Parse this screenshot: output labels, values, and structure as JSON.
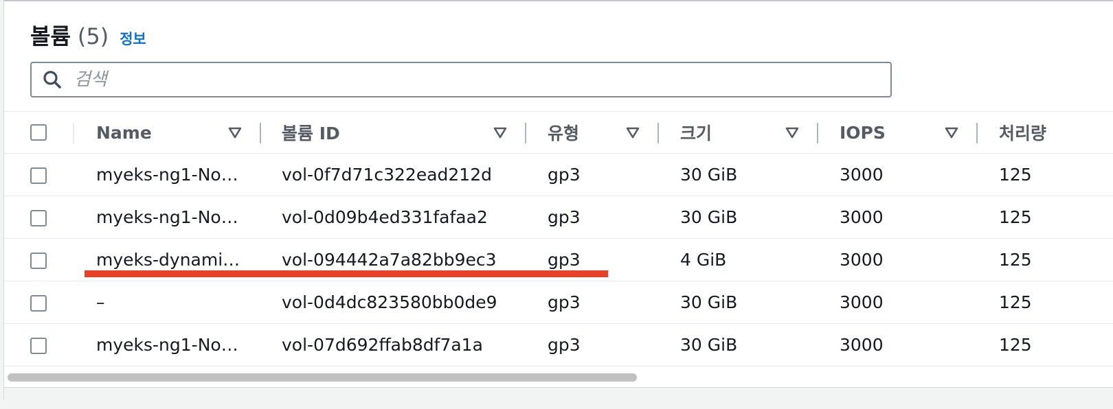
{
  "header": {
    "title": "볼륨",
    "count": "(5)",
    "info_link": "정보"
  },
  "search": {
    "placeholder": "검색",
    "value": ""
  },
  "columns": [
    {
      "label": "Name"
    },
    {
      "label": "볼륨 ID"
    },
    {
      "label": "유형"
    },
    {
      "label": "크기"
    },
    {
      "label": "IOPS"
    },
    {
      "label": "처리량"
    }
  ],
  "rows": [
    {
      "name": "myeks-ng1-No…",
      "volume_id": "vol-0f7d71c322ead212d",
      "type": "gp3",
      "size": "30 GiB",
      "iops": "3000",
      "throughput": "125"
    },
    {
      "name": "myeks-ng1-No…",
      "volume_id": "vol-0d09b4ed331fafaa2",
      "type": "gp3",
      "size": "30 GiB",
      "iops": "3000",
      "throughput": "125"
    },
    {
      "name": "myeks-dynami…",
      "volume_id": "vol-094442a7a82bb9ec3",
      "type": "gp3",
      "size": "4 GiB",
      "iops": "3000",
      "throughput": "125"
    },
    {
      "name": "–",
      "volume_id": "vol-0d4dc823580bb0de9",
      "type": "gp3",
      "size": "30 GiB",
      "iops": "3000",
      "throughput": "125"
    },
    {
      "name": "myeks-ng1-No…",
      "volume_id": "vol-07d692ffab8df7a1a",
      "type": "gp3",
      "size": "30 GiB",
      "iops": "3000",
      "throughput": "125"
    }
  ],
  "colors": {
    "link": "#0972d3",
    "highlight_underline": "#e8412a"
  },
  "icons": {
    "search": "search-icon",
    "sort": "sort-triangle-icon"
  }
}
